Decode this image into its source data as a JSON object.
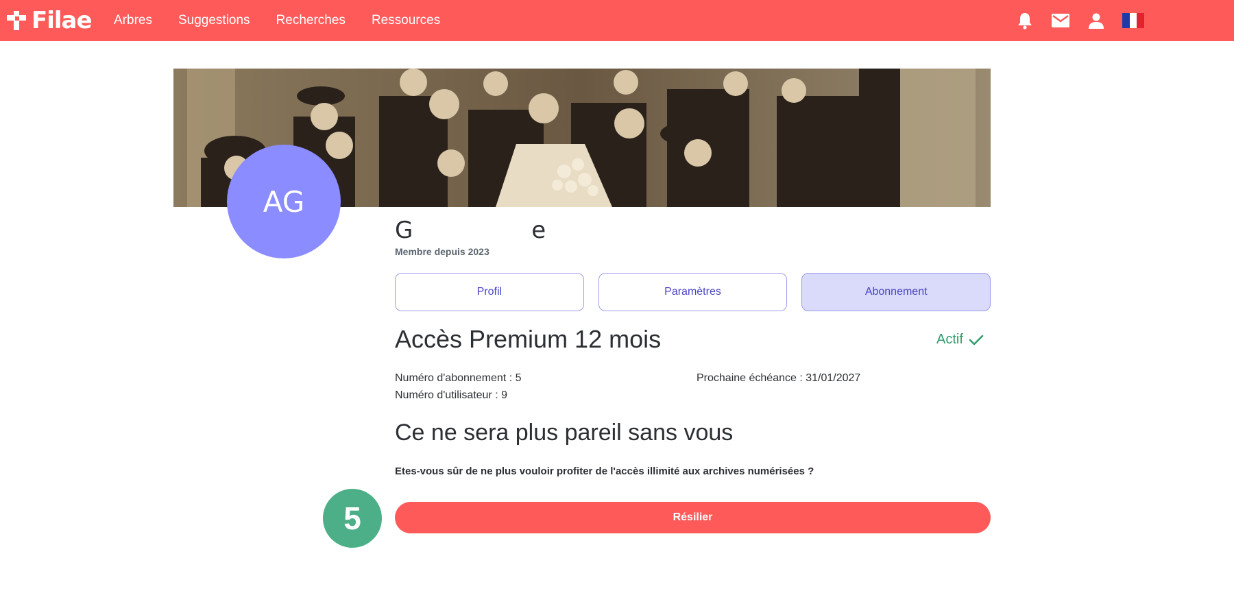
{
  "brand": {
    "name": "Filae"
  },
  "nav": {
    "items": [
      {
        "label": "Arbres"
      },
      {
        "label": "Suggestions"
      },
      {
        "label": "Recherches"
      },
      {
        "label": "Ressources"
      }
    ],
    "icons": [
      "bell-icon",
      "mail-icon",
      "user-icon",
      "flag-fr-icon"
    ]
  },
  "profile": {
    "avatar_initials": "AG",
    "name_start": "G",
    "name_end": "e",
    "member_since": "Membre depuis 2023"
  },
  "tabs": [
    {
      "label": "Profil",
      "active": false
    },
    {
      "label": "Paramètres",
      "active": false
    },
    {
      "label": "Abonnement",
      "active": true
    }
  ],
  "subscription": {
    "title": "Accès Premium 12 mois",
    "status": "Actif",
    "subscription_number": "Numéro d'abonnement : 5",
    "user_number": "Numéro d'utilisateur : 9",
    "next_due": "Prochaine échéance : 31/01/2027"
  },
  "cancel": {
    "heading": "Ce ne sera plus pareil sans vous",
    "question": "Etes-vous sûr de ne plus vouloir profiter de l'accès illimité aux archives numérisées ?",
    "button_label": "Résilier",
    "step_number": "5"
  },
  "colors": {
    "brand": "#ff5a5a",
    "accent": "#4a45c6",
    "avatar": "#8a8cff",
    "success": "#2f9c6b",
    "step_badge": "#4caf88"
  }
}
